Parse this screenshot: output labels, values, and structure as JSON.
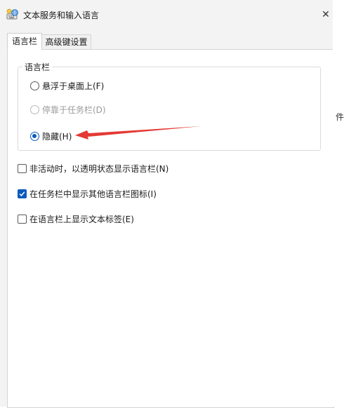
{
  "window": {
    "title": "文本服务和输入语言",
    "close_glyph": "✕"
  },
  "tabs": [
    {
      "label": "语言栏",
      "active": true
    },
    {
      "label": "高级键设置",
      "active": false
    }
  ],
  "language_bar_group": {
    "label": "语言栏",
    "options": [
      {
        "label": "悬浮于桌面上(F)",
        "checked": false,
        "disabled": false
      },
      {
        "label": "停靠于任务栏(D)",
        "checked": false,
        "disabled": true
      },
      {
        "label": "隐藏(H)",
        "checked": true,
        "disabled": false
      }
    ]
  },
  "checkboxes": [
    {
      "label": "非活动时，以透明状态显示语言栏(N)",
      "checked": false
    },
    {
      "label": "在任务栏中显示其他语言栏图标(I)",
      "checked": true
    },
    {
      "label": "在语言栏上显示文本标签(E)",
      "checked": false
    }
  ],
  "background_window": {
    "partial_text": "件"
  },
  "colors": {
    "accent": "#0a5bbd",
    "annotation_arrow": "#e53935"
  }
}
